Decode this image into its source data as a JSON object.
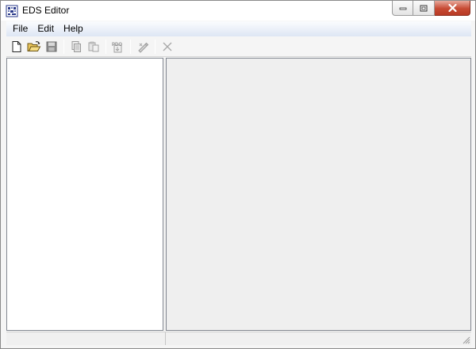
{
  "window": {
    "title": "EDS Editor",
    "app_icon": "eds-app-icon"
  },
  "caption_buttons": [
    {
      "name": "minimize-button",
      "icon": "minimize-icon"
    },
    {
      "name": "restore-button",
      "icon": "restore-icon"
    },
    {
      "name": "close-button",
      "icon": "close-icon"
    }
  ],
  "menubar": {
    "items": [
      "File",
      "Edit",
      "Help"
    ]
  },
  "toolbar": {
    "buttons": [
      {
        "name": "new-button",
        "icon": "new-document-icon",
        "enabled": true
      },
      {
        "name": "open-button",
        "icon": "open-folder-icon",
        "enabled": true
      },
      {
        "name": "save-button",
        "icon": "save-disk-icon",
        "enabled": false
      },
      {
        "name": "copy-button",
        "icon": "copy-icon",
        "enabled": false
      },
      {
        "name": "paste-button",
        "icon": "paste-icon",
        "enabled": false
      },
      {
        "name": "pdo-button",
        "icon": "pdo-icon",
        "enabled": false
      },
      {
        "name": "edit-button",
        "icon": "edit-icon",
        "enabled": false
      },
      {
        "name": "delete-button",
        "icon": "delete-x-icon",
        "enabled": false
      }
    ]
  },
  "statusbar": {
    "panes": [
      "",
      ""
    ]
  },
  "colors": {
    "menubar_gradient_bottom": "#dde6f4",
    "close_button_red": "#c74a33",
    "panel_border": "#828790",
    "right_panel_bg": "#efefef"
  }
}
